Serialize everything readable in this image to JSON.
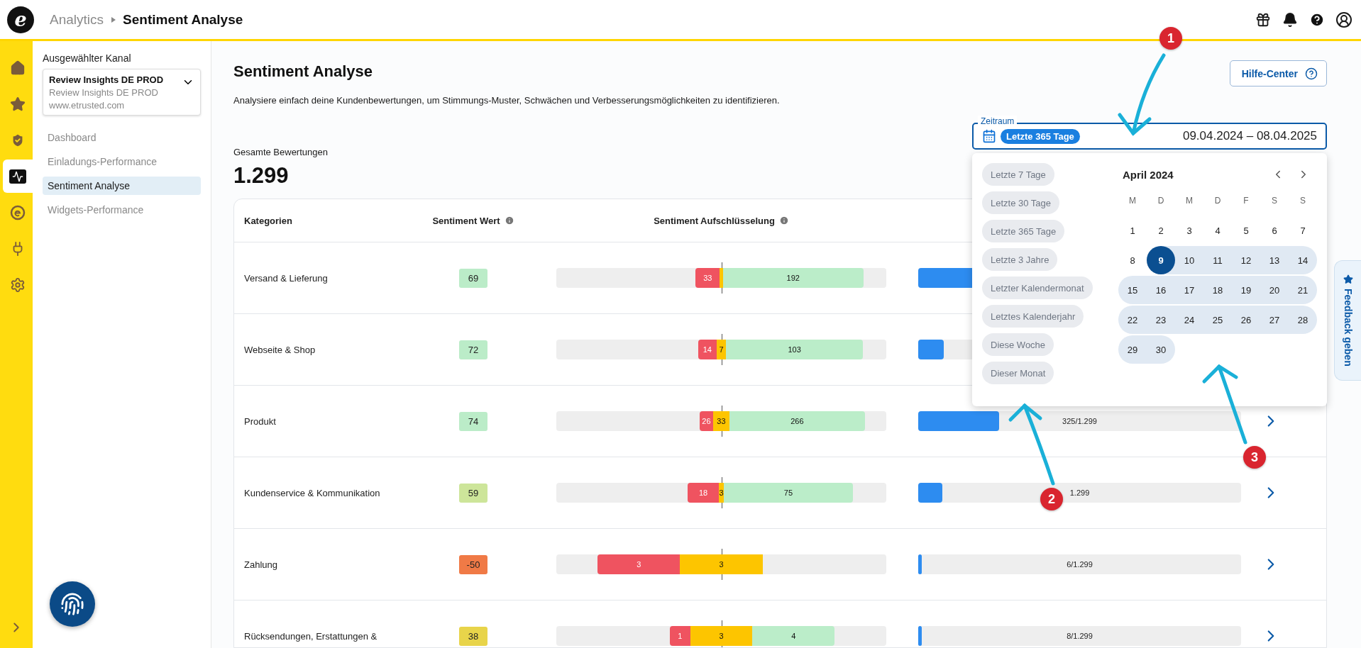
{
  "header": {
    "logo": "e",
    "breadcrumb": [
      {
        "label": "Analytics",
        "current": false
      },
      {
        "label": "Sentiment Analyse",
        "current": true
      }
    ]
  },
  "rail": {
    "items": [
      {
        "selected": false
      },
      {
        "selected": false
      },
      {
        "selected": false
      },
      {
        "selected": true
      },
      {
        "selected": false
      },
      {
        "selected": false
      },
      {
        "selected": false
      }
    ]
  },
  "sidebar": {
    "channel_label": "Ausgewählter Kanal",
    "channel": {
      "name": "Review Insights DE PROD",
      "subtitle": "Review Insights DE PROD",
      "url": "www.etrusted.com"
    },
    "items": [
      {
        "label": "Dashboard",
        "selected": false
      },
      {
        "label": "Einladungs-Performance",
        "selected": false
      },
      {
        "label": "Sentiment Analyse",
        "selected": true
      },
      {
        "label": "Widgets-Performance",
        "selected": false
      }
    ]
  },
  "page": {
    "title": "Sentiment Analyse",
    "description": "Analysiere einfach deine Kundenbewertungen, um Stimmungs-Muster, Schwächen und Verbesserungsmöglichkeiten zu identifizieren.",
    "help_button": "Hilfe-Center",
    "total_label": "Gesamte Bewertungen",
    "total_value": "1.299"
  },
  "date_range": {
    "label": "Zeitraum",
    "chip": "Letzte 365 Tage",
    "value": "09.04.2024 – 08.04.2025",
    "presets": [
      "Letzte 7 Tage",
      "Letzte 30 Tage",
      "Letzte 365 Tage",
      "Letzte 3 Jahre",
      "Letzter Kalendermonat",
      "Letztes Kalenderjahr",
      "Diese Woche",
      "Dieser Monat"
    ],
    "month": "April 2024",
    "weekdays": [
      "M",
      "D",
      "M",
      "D",
      "F",
      "S",
      "S"
    ],
    "weeks": [
      [
        {
          "day": "1",
          "selected": false,
          "in_range": false
        },
        {
          "day": "2",
          "selected": false,
          "in_range": false
        },
        {
          "day": "3",
          "selected": false,
          "in_range": false
        },
        {
          "day": "4",
          "selected": false,
          "in_range": false
        },
        {
          "day": "5",
          "selected": false,
          "in_range": false
        },
        {
          "day": "6",
          "selected": false,
          "in_range": false
        },
        {
          "day": "7",
          "selected": false,
          "in_range": false
        }
      ],
      [
        {
          "day": "8",
          "selected": false,
          "in_range": false
        },
        {
          "day": "9",
          "selected": true,
          "in_range": true
        },
        {
          "day": "10",
          "selected": false,
          "in_range": true
        },
        {
          "day": "11",
          "selected": false,
          "in_range": true
        },
        {
          "day": "12",
          "selected": false,
          "in_range": true
        },
        {
          "day": "13",
          "selected": false,
          "in_range": true
        },
        {
          "day": "14",
          "selected": false,
          "in_range": true
        }
      ],
      [
        {
          "day": "15",
          "selected": false,
          "in_range": true
        },
        {
          "day": "16",
          "selected": false,
          "in_range": true
        },
        {
          "day": "17",
          "selected": false,
          "in_range": true
        },
        {
          "day": "18",
          "selected": false,
          "in_range": true
        },
        {
          "day": "19",
          "selected": false,
          "in_range": true
        },
        {
          "day": "20",
          "selected": false,
          "in_range": true
        },
        {
          "day": "21",
          "selected": false,
          "in_range": true
        }
      ],
      [
        {
          "day": "22",
          "selected": false,
          "in_range": true
        },
        {
          "day": "23",
          "selected": false,
          "in_range": true
        },
        {
          "day": "24",
          "selected": false,
          "in_range": true
        },
        {
          "day": "25",
          "selected": false,
          "in_range": true
        },
        {
          "day": "26",
          "selected": false,
          "in_range": true
        },
        {
          "day": "27",
          "selected": false,
          "in_range": true
        },
        {
          "day": "28",
          "selected": false,
          "in_range": true
        }
      ],
      [
        {
          "day": "29",
          "selected": false,
          "in_range": true
        },
        {
          "day": "30",
          "selected": false,
          "in_range": true
        }
      ]
    ]
  },
  "table": {
    "columns": [
      "Kategorien",
      "Sentiment Wert",
      "Sentiment Aufschlüsselung"
    ],
    "rows": [
      {
        "category": "Versand & Lieferung",
        "score": "69",
        "color": "#bbecc8",
        "segments": [
          {
            "kind": "negative",
            "label": "33"
          },
          {
            "kind": "neutral"
          },
          {
            "kind": "positive",
            "label": "192"
          }
        ],
        "volume": {
          "level": 0.18
        }
      },
      {
        "category": "Webseite & Shop",
        "score": "72",
        "color": "#bbecc8",
        "segments": [
          {
            "kind": "negative",
            "label": "14"
          },
          {
            "kind": "neutral",
            "label": "7"
          },
          {
            "kind": "positive",
            "label": "103"
          }
        ],
        "volume": {
          "level": 0.08
        }
      },
      {
        "category": "Produkt",
        "score": "74",
        "color": "#bbecc8",
        "segments": [
          {
            "kind": "negative",
            "label": "26"
          },
          {
            "kind": "neutral",
            "label": "33"
          },
          {
            "kind": "positive",
            "label": "266"
          }
        ],
        "volume": {
          "level": 0.25,
          "reading": "325/1.299"
        }
      },
      {
        "category": "Kundenservice & Kommunikation",
        "score": "59",
        "color": "#cde59a",
        "segments": [
          {
            "kind": "negative",
            "label": "18"
          },
          {
            "kind": "neutral",
            "label": "3"
          },
          {
            "kind": "positive",
            "label": "75"
          }
        ],
        "volume": {
          "level": 0.074,
          "reading": "1.299"
        }
      },
      {
        "category": "Zahlung",
        "score": "-50",
        "color": "#f07a46",
        "segments": [
          {
            "kind": "negative",
            "label": "3"
          },
          {
            "kind": "neutral",
            "label": "3"
          }
        ],
        "volume": {
          "level": 0.01,
          "reading": "6/1.299"
        }
      },
      {
        "category": "Rücksendungen, Erstattungen &",
        "score": "38",
        "color": "#e8d44a",
        "segments": [
          {
            "kind": "negative",
            "label": "1"
          },
          {
            "kind": "neutral",
            "label": "3"
          },
          {
            "kind": "positive",
            "label": "4"
          }
        ],
        "volume": {
          "level": 0.01,
          "reading": "8/1.299"
        }
      }
    ]
  },
  "feedback_tab": "Feedback geben",
  "annotations": [
    {
      "label": "1"
    },
    {
      "label": "2"
    },
    {
      "label": "3"
    }
  ]
}
